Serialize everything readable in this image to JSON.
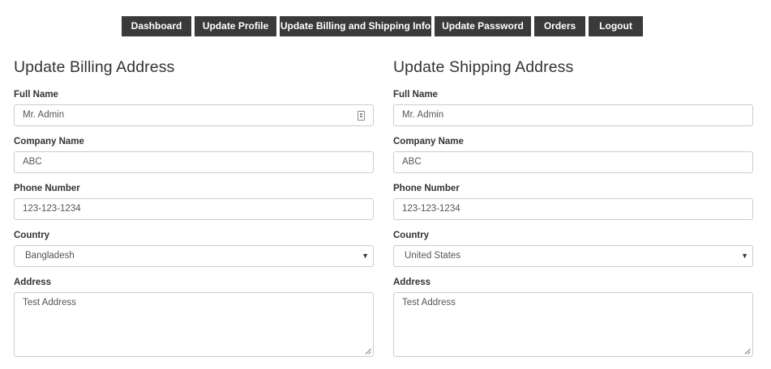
{
  "nav": {
    "items": [
      "Dashboard",
      "Update Profile",
      "Update Billing and Shipping Info",
      "Update Password",
      "Orders",
      "Logout"
    ]
  },
  "billing": {
    "title": "Update Billing Address",
    "full_name_label": "Full Name",
    "full_name": "Mr. Admin",
    "company_label": "Company Name",
    "company": "ABC",
    "phone_label": "Phone Number",
    "phone": "123-123-1234",
    "country_label": "Country",
    "country": "Bangladesh",
    "address_label": "Address",
    "address": "Test Address"
  },
  "shipping": {
    "title": "Update Shipping Address",
    "full_name_label": "Full Name",
    "full_name": "Mr. Admin",
    "company_label": "Company Name",
    "company": "ABC",
    "phone_label": "Phone Number",
    "phone": "123-123-1234",
    "country_label": "Country",
    "country": "United States",
    "address_label": "Address",
    "address": "Test Address"
  },
  "icons": {
    "dropdown": "chevron-down-icon",
    "autofill": "contact-card-icon",
    "resize": "resize-handle-icon"
  },
  "colors": {
    "nav_bg": "#3a3a3a",
    "nav_text": "#ffffff",
    "border": "#cccccc"
  }
}
